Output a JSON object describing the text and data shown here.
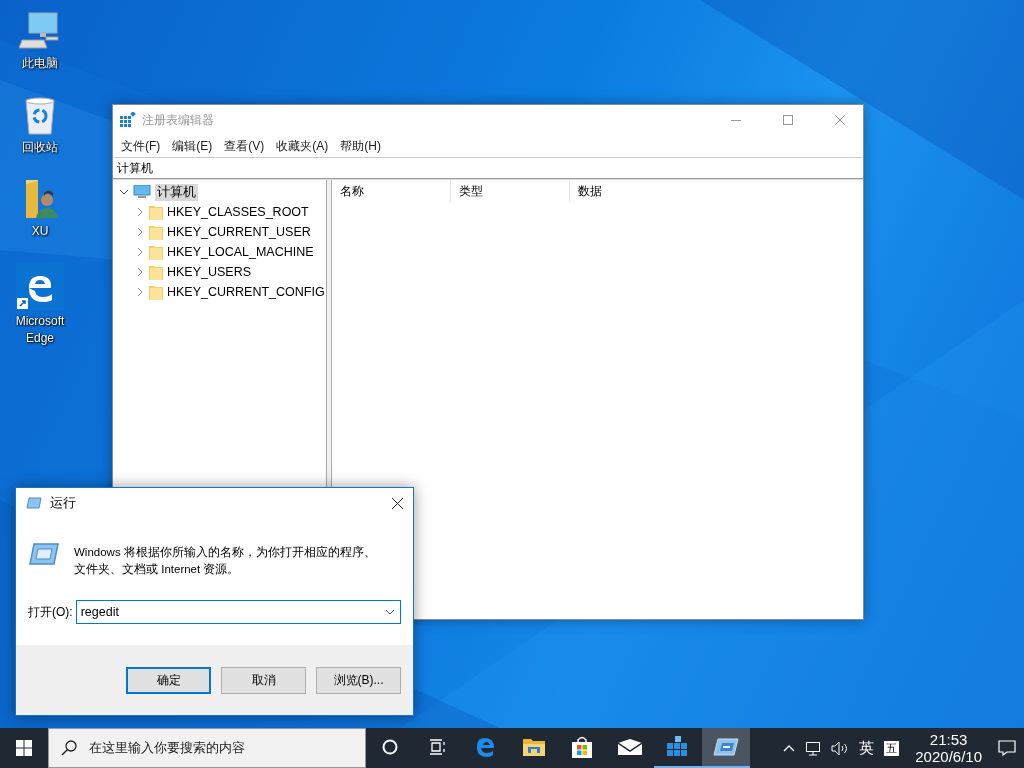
{
  "desktop": {
    "icons": [
      {
        "kind": "computer",
        "label": "此电脑"
      },
      {
        "kind": "recycle",
        "label": "回收站"
      },
      {
        "kind": "user-folder",
        "label": "XU"
      },
      {
        "kind": "edge",
        "label": "Microsoft\nEdge"
      }
    ]
  },
  "regedit": {
    "title": "注册表编辑器",
    "menu": [
      "文件(F)",
      "编辑(E)",
      "查看(V)",
      "收藏夹(A)",
      "帮助(H)"
    ],
    "address": "计算机",
    "tree": {
      "label": "计算机",
      "expanded": true,
      "selected": true,
      "children": [
        {
          "label": "HKEY_CLASSES_ROOT",
          "expanded": false
        },
        {
          "label": "HKEY_CURRENT_USER",
          "expanded": false
        },
        {
          "label": "HKEY_LOCAL_MACHINE",
          "expanded": false
        },
        {
          "label": "HKEY_USERS",
          "expanded": false
        },
        {
          "label": "HKEY_CURRENT_CONFIG",
          "expanded": false
        }
      ]
    },
    "columns": [
      "名称",
      "类型",
      "数据"
    ]
  },
  "run": {
    "title": "运行",
    "description": [
      "Windows 将根据你所输入的名称，为你打开相应的程序、",
      "文件夹、文档或 Internet 资源。"
    ],
    "open_label": "打开(O):",
    "value": "regedit",
    "buttons": [
      {
        "label": "确定",
        "default": true
      },
      {
        "label": "取消",
        "default": false
      },
      {
        "label": "浏览(B)...",
        "default": false
      }
    ]
  },
  "taskbar": {
    "search": {
      "placeholder": "在这里输入你要搜索的内容"
    },
    "apps": [
      {
        "kind": "cortana",
        "running": false,
        "active": false
      },
      {
        "kind": "taskview",
        "running": false,
        "active": false
      },
      {
        "kind": "edge",
        "running": false,
        "active": false
      },
      {
        "kind": "explorer",
        "running": false,
        "active": false
      },
      {
        "kind": "store",
        "running": false,
        "active": false
      },
      {
        "kind": "mail",
        "running": false,
        "active": false
      },
      {
        "kind": "regedit",
        "running": true,
        "active": false
      },
      {
        "kind": "run",
        "running": true,
        "active": true
      }
    ],
    "ime": "英",
    "ime_mode": "五",
    "time": "21:53",
    "date": "2020/6/10"
  }
}
